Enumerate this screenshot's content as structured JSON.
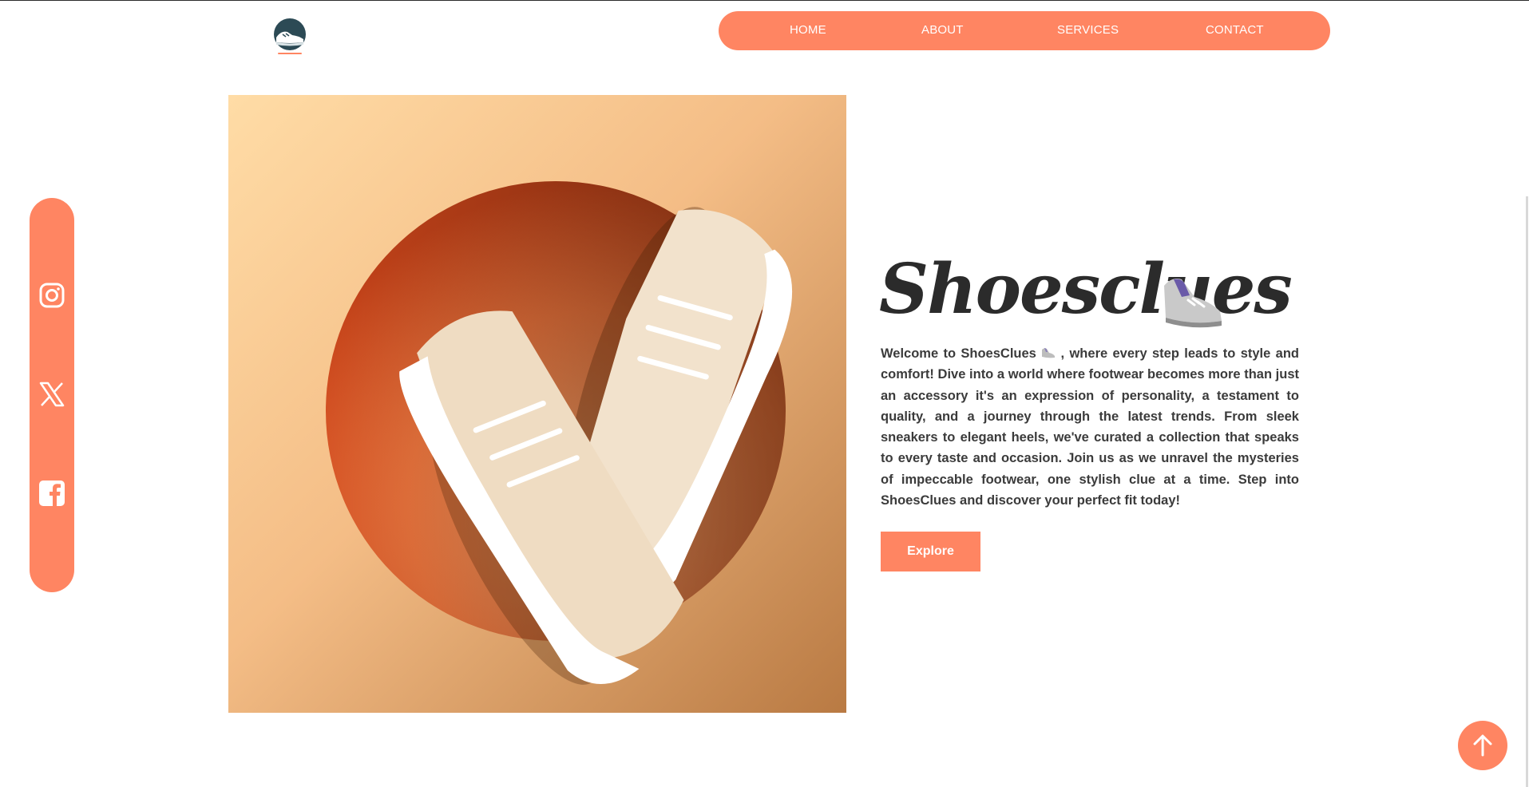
{
  "nav": {
    "items": [
      {
        "label": "HOME"
      },
      {
        "label": "ABOUT"
      },
      {
        "label": "SERVICES"
      },
      {
        "label": "CONTACT"
      }
    ]
  },
  "social": {
    "icons": [
      "instagram-icon",
      "x-icon",
      "facebook-icon"
    ]
  },
  "hero": {
    "title": "Shoesclues",
    "description_before": "Welcome to ShoesClues",
    "description_after": ", where every step leads to style and comfort! Dive into a world where footwear becomes more than just an accessory it's an expression of personality, a testament to quality, and a journey through the latest trends. From sleek sneakers to elegant heels, we've curated a collection that speaks to every taste and occasion. Join us as we unravel the mysteries of impeccable footwear, one stylish clue at a time. Step into ShoesClues and discover your perfect fit today!",
    "explore_label": "Explore"
  },
  "colors": {
    "accent": "#ff8562",
    "title": "#2b2b2b",
    "text": "#3b3b3b"
  }
}
